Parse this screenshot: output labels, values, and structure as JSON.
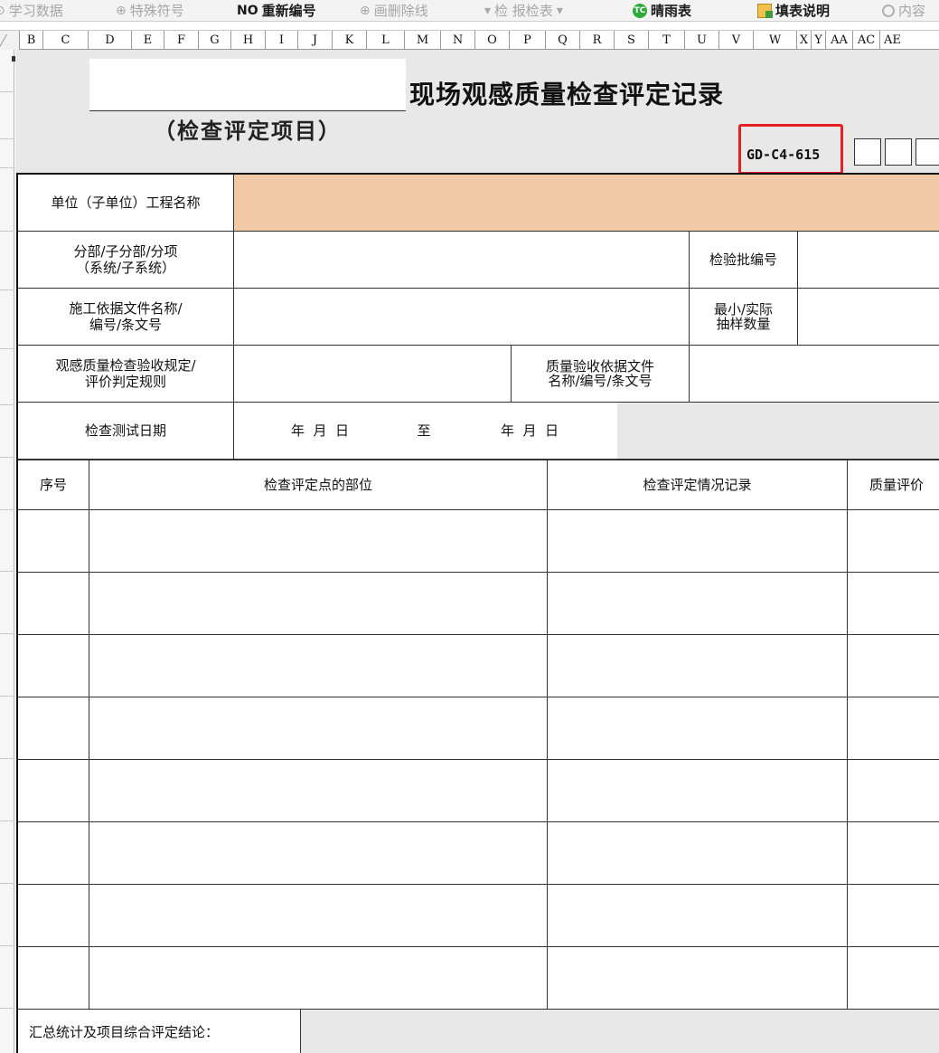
{
  "toolbar": {
    "items": [
      {
        "label": "学习数据",
        "icon": "study-data-icon",
        "state": "disabled"
      },
      {
        "label": "特殊符号",
        "icon": "special-symbol-icon",
        "state": "disabled"
      },
      {
        "label": "重新编号",
        "icon": "renumber-icon",
        "prefix": "NO",
        "state": "enabled"
      },
      {
        "label": "画删除线",
        "icon": "strikethrough-icon",
        "state": "disabled"
      },
      {
        "label": "检 报检表",
        "icon": "dropdown-icon",
        "state": "disabled"
      },
      {
        "label": "晴雨表",
        "icon": "weather-icon",
        "badge": "TC",
        "state": "enabled"
      },
      {
        "label": "填表说明",
        "icon": "fill-guide-icon",
        "state": "enabled"
      },
      {
        "label": "内容",
        "icon": "content-search-icon",
        "state": "disabled"
      }
    ]
  },
  "columns": [
    "B",
    "C",
    "D",
    "E",
    "F",
    "G",
    "H",
    "I",
    "J",
    "K",
    "L",
    "M",
    "N",
    "O",
    "P",
    "Q",
    "R",
    "S",
    "T",
    "U",
    "V",
    "W",
    "X",
    "Y",
    "AA",
    "AC",
    "AE"
  ],
  "form": {
    "title": "现场观感质量检查评定记录",
    "subtitle": "（检查评定项目）",
    "code": "GD-C4-615",
    "accent_color": "#f1c9a5",
    "highlight_color": "#e62020"
  },
  "fields": {
    "unit_project_name": "单位（子单位）工程名称",
    "division": "分部/子分部/分项\n（系统/子系统）",
    "inspection_lot_no": "检验批编号",
    "construction_basis": "施工依据文件名称/\n编号/条文号",
    "sample_qty": "最小/实际\n抽样数量",
    "acceptance_rule": "观感质量检查验收规定/\n评价判定规则",
    "acceptance_basis": "质量验收依据文件\n名称/编号/条文号",
    "test_date": "检查测试日期",
    "date_from": "年  月  日",
    "date_to_label": "至",
    "date_to": "年  月  日"
  },
  "table": {
    "headers": [
      "序号",
      "检查评定点的部位",
      "检查评定情况记录",
      "质量评价"
    ],
    "empty_rows": 8,
    "summary_label": "汇总统计及项目综合评定结论："
  }
}
